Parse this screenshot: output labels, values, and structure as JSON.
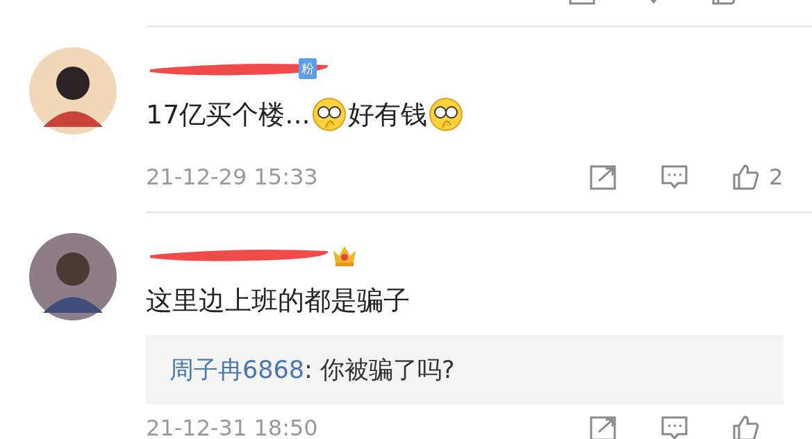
{
  "comments": [
    {
      "badge": "粉",
      "crown": false,
      "content": [
        {
          "kind": "text",
          "text": "17亿买个楼..."
        },
        {
          "kind": "emoji"
        },
        {
          "kind": "text",
          "text": "好有钱"
        },
        {
          "kind": "emoji"
        }
      ],
      "time": "21-12-29 15:33",
      "likes": "2"
    },
    {
      "crown": true,
      "content": [
        {
          "kind": "text",
          "text": "这里边上班的都是骗子"
        }
      ],
      "time": "21-12-31 18:50",
      "reply": {
        "author": "周子冉6868",
        "text": ": 你被骗了吗?"
      }
    }
  ]
}
